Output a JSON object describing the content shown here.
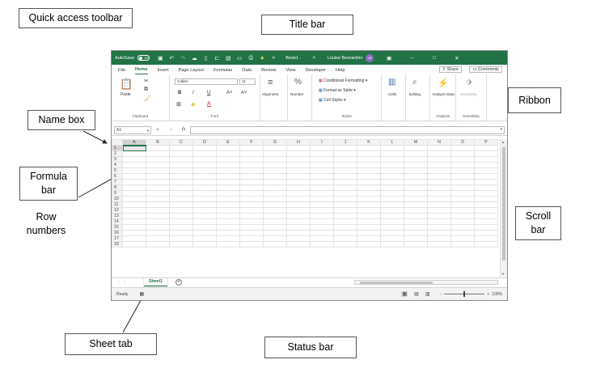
{
  "labels": {
    "quick_access_toolbar": "Quick access toolbar",
    "title_bar": "Title bar",
    "ribbon": "Ribbon",
    "name_box": "Name box",
    "formula_bar": "Formula\nbar",
    "row_numbers": "Row\nnumbers",
    "scroll_bar": "Scroll\nbar",
    "sheet_tab": "Sheet tab",
    "status_bar": "Status bar"
  },
  "excel": {
    "titlebar": {
      "autosave": "AutoSave",
      "toggle": "Off",
      "book": "Book1 -",
      "user": "Louise Bernardini",
      "avatar": "LB",
      "minimize": "–",
      "restore": "□",
      "close": "✕"
    },
    "tabs": [
      "File",
      "Home",
      "Insert",
      "Page Layout",
      "Formulas",
      "Data",
      "Review",
      "View",
      "Developer",
      "Help"
    ],
    "active_tab": "Home",
    "share": "Share",
    "comments": "Comments",
    "ribbon": {
      "paste": "Paste",
      "clipboard": "Clipboard",
      "font_name": "Calibri",
      "font_size": "11",
      "font": "Font",
      "alignment": "Alignment",
      "number": "Number",
      "conditional_formatting": "Conditional Formatting ▾",
      "format_as_table": "Format as Table ▾",
      "cell_styles": "Cell Styles ▾",
      "styles": "Styles",
      "cells": "Cells",
      "editing": "Editing",
      "analyze_data": "Analyze Data",
      "analysis": "Analysis",
      "sensitivity": "Sensitivity",
      "sensitivity_group": "Sensitivity"
    },
    "namebox": "A1",
    "fx": "fx",
    "columns": [
      "A",
      "B",
      "C",
      "D",
      "E",
      "F",
      "G",
      "H",
      "I",
      "J",
      "K",
      "L",
      "M",
      "N",
      "O",
      "P"
    ],
    "rows": [
      "1",
      "2",
      "3",
      "4",
      "5",
      "6",
      "7",
      "8",
      "9",
      "10",
      "11",
      "12",
      "13",
      "14",
      "15",
      "16",
      "17",
      "18"
    ],
    "sheet_name": "Sheet1",
    "add_sheet": "+",
    "status": "Ready",
    "zoom": "100%"
  }
}
